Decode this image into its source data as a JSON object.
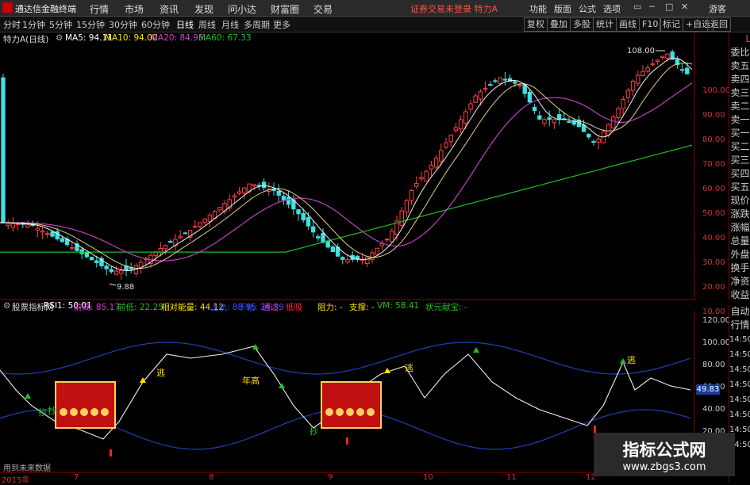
{
  "titlebar": {
    "app_title": "通达信金融终端",
    "menu": [
      "行情",
      "市场",
      "资讯",
      "发现",
      "问小达",
      "财富圈",
      "交易"
    ],
    "alert": "证券交易未登录 特力A",
    "right_menu": [
      "功能",
      "版面",
      "公式",
      "选项"
    ],
    "guest": "游客"
  },
  "toolbar": {
    "periods": [
      "分时",
      "1分钟",
      "5分钟",
      "15分钟",
      "30分钟",
      "60分钟",
      "日线",
      "周线",
      "月线",
      "多周期",
      "更多"
    ],
    "active_period": "日线",
    "right_buttons": [
      "复权",
      "叠加",
      "多股",
      "统计",
      "画线",
      "F10",
      "标记",
      "+自选",
      "返回"
    ]
  },
  "main_chart": {
    "stock_label": "特力A(日线)",
    "ma": [
      {
        "label": "MA5: 94.11",
        "color": "#ffffff"
      },
      {
        "label": "MA10: 94.00",
        "color": "#ffe000"
      },
      {
        "label": "MA20: 84.95",
        "color": "#d040d0"
      },
      {
        "label": "MA60: 67.33",
        "color": "#20c020"
      }
    ],
    "high_marker": "108.00",
    "low_marker": "9.88",
    "y_ticks": [
      "100.00",
      "90.00",
      "80.00",
      "70.00",
      "60.00",
      "50.00",
      "40.00",
      "30.00",
      "20.00",
      "10.00"
    ]
  },
  "sub_chart": {
    "name": "股票指标网",
    "items": [
      {
        "label": "RSI1: 50.01",
        "color": "#ffffff"
      },
      {
        "label": "前高: 85.17",
        "color": "#d040d0"
      },
      {
        "label": "前低: 22.25",
        "color": "#20c020"
      },
      {
        "label": "相对能量: 44.12",
        "color": "#ffe000"
      },
      {
        "label": "上轨: 88.95",
        "color": "#3050ff"
      },
      {
        "label": "下轨: 24.39",
        "color": "#3050ff"
      },
      {
        "label": "通达: ",
        "color": "#d040d0"
      },
      {
        "label": "低吸",
        "color": "#ff3030"
      },
      {
        "label": "阻力: -",
        "color": "#ffe000"
      },
      {
        "label": "支撑: -",
        "color": "#ffe000"
      },
      {
        "label": "VM: 58.41",
        "color": "#20c020"
      },
      {
        "label": "状元献宝: -",
        "color": "#20c020"
      }
    ],
    "y_ticks": [
      "120.00",
      "100.00",
      "80.00",
      "60.00",
      "40.00",
      "20.00"
    ],
    "current_value": "49.83",
    "signals": [
      "逃",
      "年高",
      "逃",
      "逃",
      "抄",
      "抄",
      "抄"
    ],
    "footer_note": "用到未来数据"
  },
  "right_side_top": [
    "L",
    "委比",
    "卖五",
    "卖四",
    "卖三",
    "卖二",
    "卖一",
    "买一",
    "买二",
    "买三",
    "买四",
    "买五",
    "现价",
    "涨跌",
    "涨幅",
    "总量",
    "外盘",
    "换手",
    "净资",
    "收益"
  ],
  "right_side_bottom": [
    "自动",
    "行情",
    "14:50",
    "14:50",
    "14:50",
    "14:50",
    "14:50",
    "14:50",
    "14:50",
    "14:50"
  ],
  "x_axis": [
    "2015年",
    "7",
    "8",
    "9",
    "10",
    "11",
    "12"
  ],
  "watermark": {
    "line1": "指标公式网",
    "line2": "www.zbgs3.com"
  }
}
